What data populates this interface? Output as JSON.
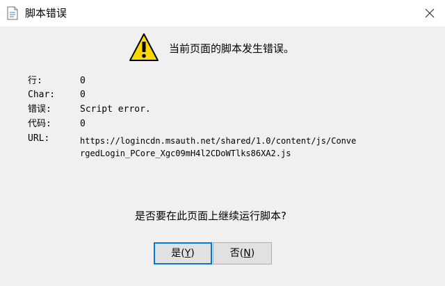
{
  "window": {
    "title": "脚本错误",
    "close_glyph": "✕"
  },
  "message": {
    "headline": "当前页面的脚本发生错误。",
    "question": "是否要在此页面上继续运行脚本?"
  },
  "details": {
    "line_label": "行:",
    "line_value": "0",
    "char_label": "Char:",
    "char_value": "0",
    "error_label": "错误:",
    "error_value": "Script error.",
    "code_label": "代码:",
    "code_value": "0",
    "url_label": "URL:",
    "url_line1": "https://logincdn.msauth.net/shared/1.0/content/js/Conve",
    "url_line2": "rgedLogin_PCore_Xgc09mH4l2CDoWTlks86XA2.js"
  },
  "buttons": {
    "yes_text": "是(",
    "yes_key": "Y",
    "yes_close": ")",
    "no_text": "否(",
    "no_key": "N",
    "no_close": ")"
  },
  "colors": {
    "warning_fill": "#ffd700",
    "focus_border": "#0078d7"
  },
  "icons": {
    "title": "document-icon",
    "warning": "warning-icon",
    "close": "close-icon"
  }
}
